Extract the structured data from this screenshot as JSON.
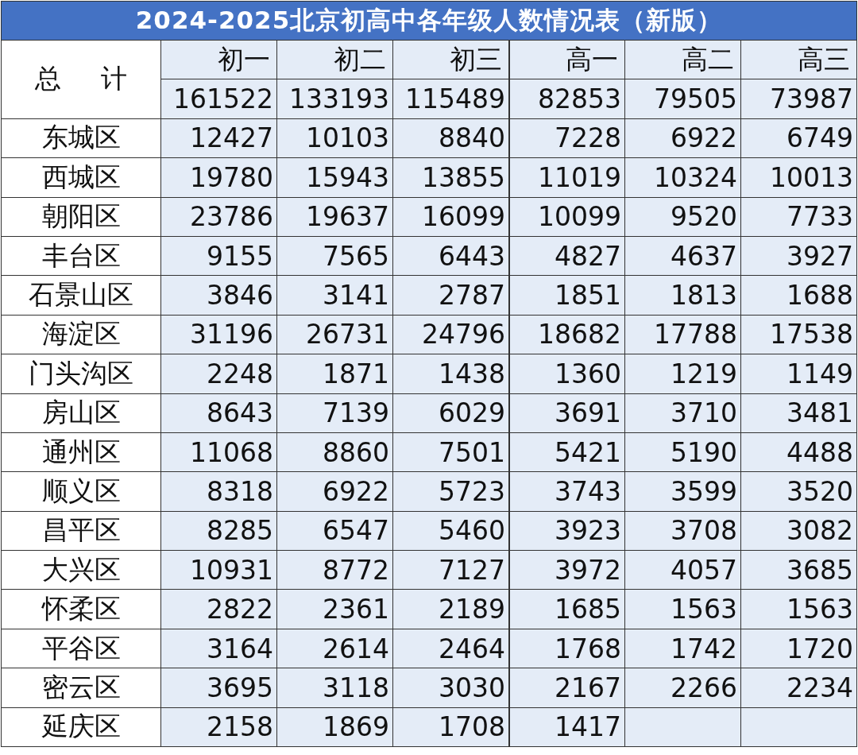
{
  "title": "2024-2025北京初高中各年级人数情况表（新版）",
  "columns": [
    "初一",
    "初二",
    "初三",
    "高一",
    "高二",
    "高三"
  ],
  "total": {
    "label": "总 计",
    "values": [
      "161522",
      "133193",
      "115489",
      "82853",
      "79505",
      "73987"
    ]
  },
  "rows": [
    {
      "district": "东城区",
      "values": [
        "12427",
        "10103",
        "8840",
        "7228",
        "6922",
        "6749"
      ]
    },
    {
      "district": "西城区",
      "values": [
        "19780",
        "15943",
        "13855",
        "11019",
        "10324",
        "10013"
      ]
    },
    {
      "district": "朝阳区",
      "values": [
        "23786",
        "19637",
        "16099",
        "10099",
        "9520",
        "7733"
      ]
    },
    {
      "district": "丰台区",
      "values": [
        "9155",
        "7565",
        "6443",
        "4827",
        "4637",
        "3927"
      ]
    },
    {
      "district": "石景山区",
      "values": [
        "3846",
        "3141",
        "2787",
        "1851",
        "1813",
        "1688"
      ]
    },
    {
      "district": "海淀区",
      "values": [
        "31196",
        "26731",
        "24796",
        "18682",
        "17788",
        "17538"
      ]
    },
    {
      "district": "门头沟区",
      "values": [
        "2248",
        "1871",
        "1438",
        "1360",
        "1219",
        "1149"
      ]
    },
    {
      "district": "房山区",
      "values": [
        "8643",
        "7139",
        "6029",
        "3691",
        "3710",
        "3481"
      ]
    },
    {
      "district": "通州区",
      "values": [
        "11068",
        "8860",
        "7501",
        "5421",
        "5190",
        "4488"
      ]
    },
    {
      "district": "顺义区",
      "values": [
        "8318",
        "6922",
        "5723",
        "3743",
        "3599",
        "3520"
      ]
    },
    {
      "district": "昌平区",
      "values": [
        "8285",
        "6547",
        "5460",
        "3923",
        "3708",
        "3082"
      ]
    },
    {
      "district": "大兴区",
      "values": [
        "10931",
        "8772",
        "7127",
        "3972",
        "4057",
        "3685"
      ]
    },
    {
      "district": "怀柔区",
      "values": [
        "2822",
        "2361",
        "2189",
        "1685",
        "1563",
        "1563"
      ]
    },
    {
      "district": "平谷区",
      "values": [
        "3164",
        "2614",
        "2464",
        "1768",
        "1742",
        "1720"
      ]
    },
    {
      "district": "密云区",
      "values": [
        "3695",
        "3118",
        "3030",
        "2167",
        "2266",
        "2234"
      ]
    },
    {
      "district": "延庆区",
      "values": [
        "2158",
        "1869",
        "1708",
        "1417"
      ]
    }
  ]
}
